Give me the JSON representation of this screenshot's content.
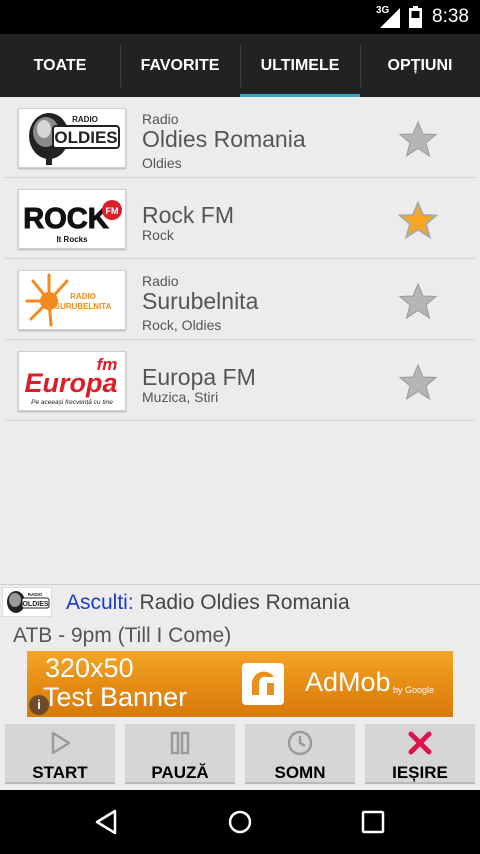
{
  "status_bar": {
    "network": "3G",
    "time": "8:38"
  },
  "tabs": [
    {
      "label": "TOATE",
      "active": false
    },
    {
      "label": "FAVORITE",
      "active": false
    },
    {
      "label": "ULTIMELE",
      "active": true
    },
    {
      "label": "OPȚIUNI",
      "active": false
    }
  ],
  "stations": [
    {
      "prefix": "Radio",
      "name": "Oldies Romania",
      "genres": "Oldies",
      "favorite": false,
      "logo": {
        "top_text": "RADIO",
        "main_text": "OLDIES"
      }
    },
    {
      "prefix": "",
      "name": "Rock FM",
      "genres": "Rock",
      "favorite": true,
      "logo": {
        "main_text": "ROCK",
        "badge": "FM",
        "bottom_text": "It Rocks"
      }
    },
    {
      "prefix": "Radio",
      "name": "Surubelnita",
      "genres": "Rock, Oldies",
      "favorite": false,
      "logo": {
        "main_text": "RADIO",
        "sub_text": "SURUBELNITA"
      }
    },
    {
      "prefix": "",
      "name": "Europa FM",
      "genres": "Muzica, Stiri",
      "favorite": false,
      "logo": {
        "main_text": "Europa",
        "badge": "fm",
        "bottom_text": "Pe aceeași frecvență cu tine"
      }
    }
  ],
  "now_playing": {
    "label": "Asculti:",
    "station": "Radio Oldies Romania",
    "song": "ATB - 9pm (Till I Come)",
    "logo": {
      "top_text": "RADIO",
      "main_text": "OLDIES"
    }
  },
  "ad_banner": {
    "line1": "320x50",
    "line2": "Test Banner",
    "brand": "AdMob",
    "by": "by Google",
    "info": "i"
  },
  "controls": [
    {
      "label": "START",
      "icon": "play-icon"
    },
    {
      "label": "PAUZĂ",
      "icon": "pause-icon"
    },
    {
      "label": "SOMN",
      "icon": "clock-icon"
    },
    {
      "label": "IEȘIRE",
      "icon": "close-icon"
    }
  ],
  "colors": {
    "tab_bar": "#222222",
    "tab_indicator": "#36a7c4",
    "now_playing_label": "#1a3cc8",
    "star_favorite": "#f5a623",
    "star_empty": "#b5b5b5",
    "exit_icon": "#e0144c",
    "banner": "#e8901a"
  }
}
